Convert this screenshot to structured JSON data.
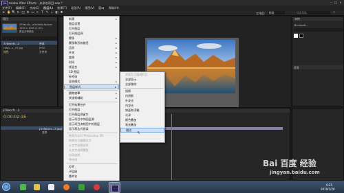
{
  "app": {
    "title": "Adobe After Effects - 未命名项目.aep *",
    "logo_text": "Ae"
  },
  "menubar": [
    "文件(F)",
    "编辑(E)",
    "合成(C)",
    "图层(L)",
    "效果(T)",
    "动画(A)",
    "视图(V)",
    "窗口",
    "帮助(H)"
  ],
  "toolbar": {
    "workspace_label": "工作区:",
    "workspace_value": "标准",
    "search_placeholder": "搜索帮助"
  },
  "project_panel": {
    "title": "项目",
    "footage_name": "378eccfc...a9b3d6b.fbcbab",
    "footage_size": "1500 x 1000 (1.00)",
    "footage_color": "数百万种颜色",
    "items": [
      {
        "name": "378eccfc...2",
        "kind": "合成"
      },
      {
        "name": "r4b0...c_75.jpg",
        "kind": "JPEG"
      },
      {
        "name": "纯色",
        "kind": "文件夹"
      }
    ]
  },
  "timeline": {
    "tab": "378eccfc...2",
    "timecode": "0:00:02:16",
    "layer_name": "[378eccfc...2.jpg]",
    "layer_sub": "变换"
  },
  "right_panel": {
    "title": "字符",
    "font": "Microsoft...",
    "tab2": "段落"
  },
  "layer_menu": {
    "items": [
      {
        "label": "新建",
        "disabled": false,
        "submenu": true
      },
      {
        "label": "图层设置",
        "disabled": false
      },
      {
        "label": "打开图层",
        "disabled": false
      },
      {
        "label": "打开图层源",
        "disabled": false
      },
      {
        "label": "蒙版",
        "disabled": false,
        "submenu": true
      },
      {
        "label": "蒙版和形状路径",
        "disabled": false,
        "submenu": true
      },
      {
        "label": "品质",
        "disabled": false,
        "submenu": true
      },
      {
        "label": "开关",
        "disabled": false,
        "submenu": true
      },
      {
        "label": "变换",
        "disabled": false,
        "submenu": true
      },
      {
        "label": "时间",
        "disabled": false,
        "submenu": true
      },
      {
        "label": "帧混合",
        "disabled": false,
        "submenu": true
      },
      {
        "label": "3D 图层",
        "disabled": false
      },
      {
        "label": "参考线",
        "disabled": false
      },
      {
        "label": "混合模式",
        "disabled": false,
        "submenu": true
      },
      {
        "label": "图层样式",
        "disabled": false,
        "submenu": true,
        "highlight": true
      },
      {
        "label": "跟踪遮罩",
        "disabled": false,
        "submenu": true
      },
      {
        "label": "关键帧辅助",
        "disabled": false,
        "submenu": true
      },
      {
        "label": "打开效果控件",
        "disabled": false
      },
      {
        "label": "打开图层",
        "disabled": false
      },
      {
        "label": "打开图层源窗口",
        "disabled": false
      },
      {
        "label": "显示项目中的图层源",
        "disabled": false
      },
      {
        "label": "显示项目流程图中的图层",
        "disabled": false
      },
      {
        "label": "显示表达式错误",
        "disabled": false
      },
      {
        "label": "转换为实时 Photoshop 3D",
        "disabled": true
      },
      {
        "label": "转换为可编辑文字",
        "disabled": true
      },
      {
        "label": "从文字创建形状",
        "disabled": true
      },
      {
        "label": "从文字创建蒙版",
        "disabled": true
      },
      {
        "label": "自动追踪",
        "disabled": true
      },
      {
        "label": "预合成",
        "disabled": true
      },
      {
        "label": "反转",
        "disabled": false
      },
      {
        "label": "子层级",
        "disabled": false
      },
      {
        "label": "重命名",
        "disabled": false
      }
    ]
  },
  "style_submenu": {
    "items": [
      {
        "label": "转换为可编辑样式",
        "disabled": true
      },
      {
        "label": "全部显示",
        "disabled": false
      },
      {
        "label": "全部移除",
        "disabled": false
      },
      {
        "label": "投影",
        "disabled": false,
        "sep_before": true
      },
      {
        "label": "内阴影",
        "disabled": false
      },
      {
        "label": "外发光",
        "disabled": false
      },
      {
        "label": "内发光",
        "disabled": false
      },
      {
        "label": "斜面和浮雕",
        "disabled": false
      },
      {
        "label": "光泽",
        "disabled": false
      },
      {
        "label": "颜色叠加",
        "disabled": false
      },
      {
        "label": "渐变叠加",
        "disabled": false
      },
      {
        "label": "描边",
        "disabled": false,
        "highlight": true
      }
    ]
  },
  "status": {
    "view_label": "活动摄像机",
    "zoom": "(33.3%)",
    "views": "1 个..."
  },
  "taskbar": {
    "time": "6:25",
    "date": "2019/1/28"
  },
  "watermark": {
    "brand": "Bai 百度 经验",
    "url": "jingyan.baidu.com"
  },
  "colors": {
    "accent_orange": "#e8a13a",
    "timecode_yellow": "#e0b13a",
    "playhead_red": "#d24a4a"
  }
}
